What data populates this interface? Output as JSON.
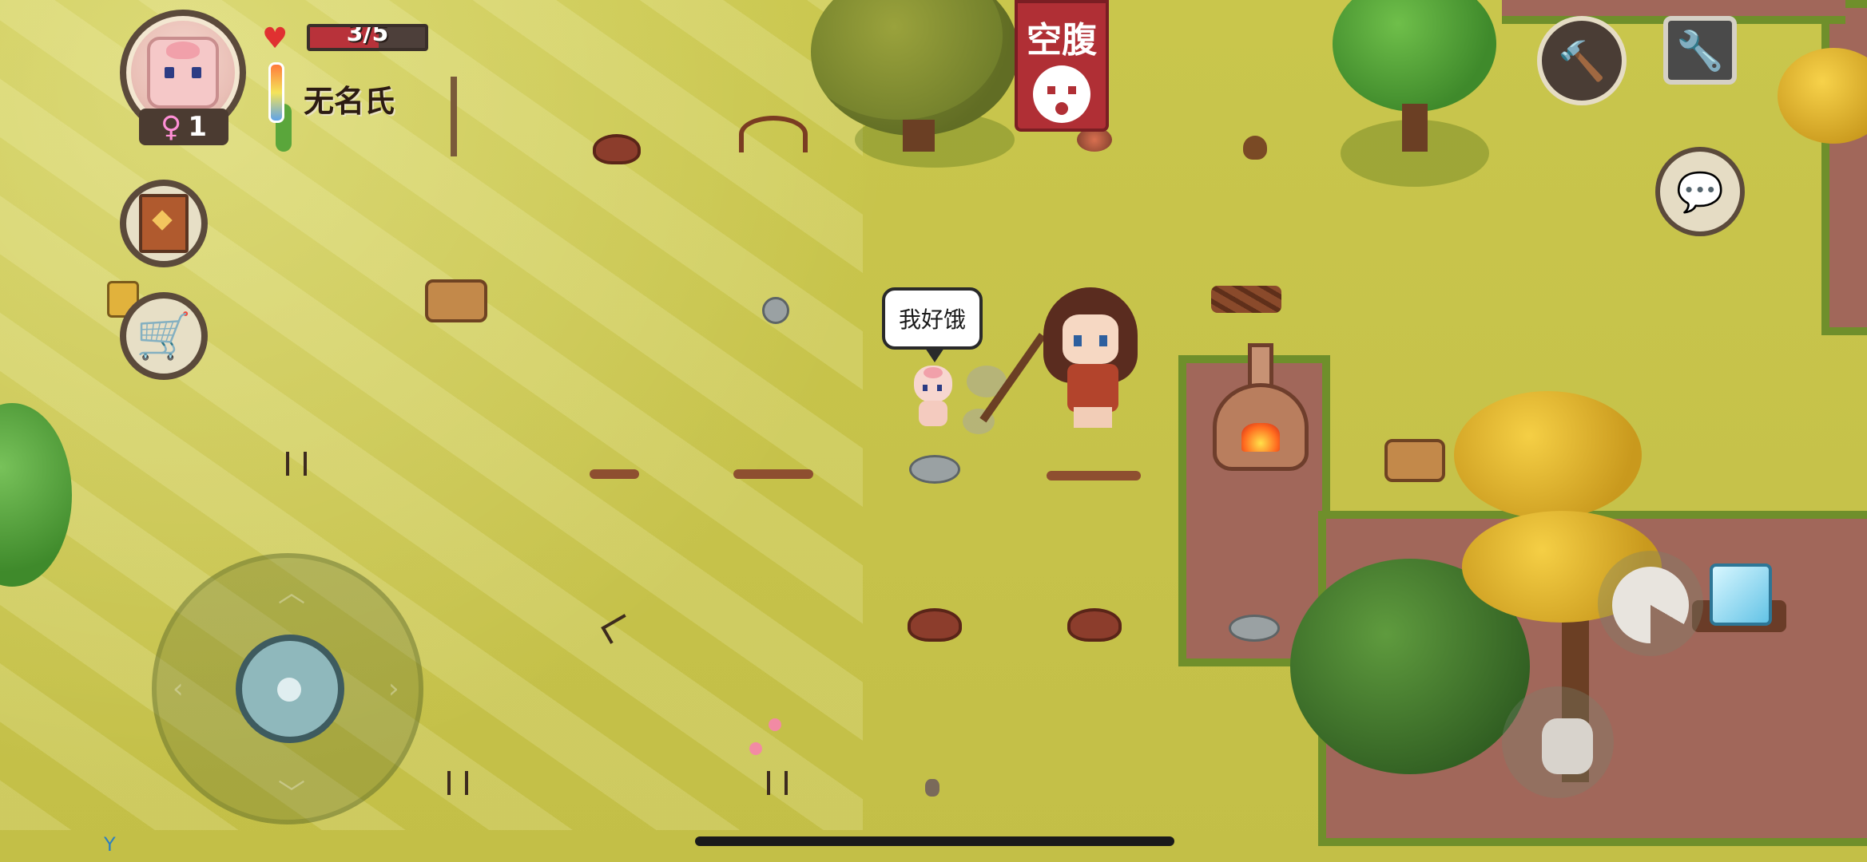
{
  "hud": {
    "health_text": "3/5",
    "health_fraction": 0.6,
    "player_name": "无名氏",
    "gender_symbol": "♀",
    "child_count": "1"
  },
  "status": {
    "label": "空腹"
  },
  "speech": {
    "text": "我好饿"
  },
  "icons": {
    "heart": "heart-icon",
    "thermometer": "thermometer-icon",
    "hammer": "hammer-icon",
    "wrench": "wrench-icon",
    "chat": "chat-icon",
    "book": "book-icon",
    "cart": "cart-icon",
    "eat": "eat-icon",
    "grab": "grab-icon"
  },
  "colors": {
    "grass": "#c7c44a",
    "dirt": "#a1675a",
    "health": "#b8323a",
    "status_banner": "#b02f35"
  }
}
